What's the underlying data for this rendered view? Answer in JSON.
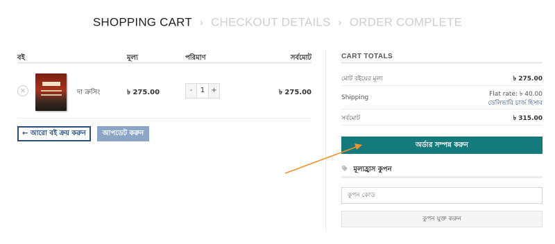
{
  "steps": {
    "cart": "SHOPPING CART",
    "checkout": "CHECKOUT DETAILS",
    "complete": "ORDER COMPLETE",
    "separator": "›"
  },
  "cart": {
    "headers": {
      "product": "বই",
      "price": "মূল্য",
      "quantity": "পরিমাণ",
      "subtotal": "সর্বমোট"
    },
    "items": [
      {
        "remove_icon": "×",
        "name": "দা ক্রসিং",
        "price": "৳ 275.00",
        "quantity": "1",
        "subtotal": "৳ 275.00"
      }
    ],
    "qty_minus": "-",
    "qty_plus": "+",
    "continue_label": "← আরো বই ক্রয় করুন",
    "update_label": "আপডেট করুন"
  },
  "totals": {
    "title": "CART TOTALS",
    "subtotal_label": "মোট বইয়ের মূল্য",
    "subtotal_value": "৳ 275.00",
    "shipping_label": "Shipping",
    "shipping_value": "Flat rate: ৳ 40.00",
    "shipping_note": "ডেলিভারি চার্জ হিসাব",
    "total_label": "সর্বমোট",
    "total_value": "৳ 315.00",
    "checkout_label": "অর্ডার সম্পন্ন করুন"
  },
  "coupon": {
    "title": "মূল্যহ্রাস কুপন",
    "placeholder": "কুপন কোড",
    "apply_label": "কুপন যুক্ত করুন"
  },
  "colors": {
    "accent": "#157a7b",
    "link": "#2a4f7f",
    "arrow": "#f0932b"
  },
  "icons": {
    "remove": "remove-icon",
    "coupon": "tag-icon",
    "annotation": "arrow-annotation"
  }
}
